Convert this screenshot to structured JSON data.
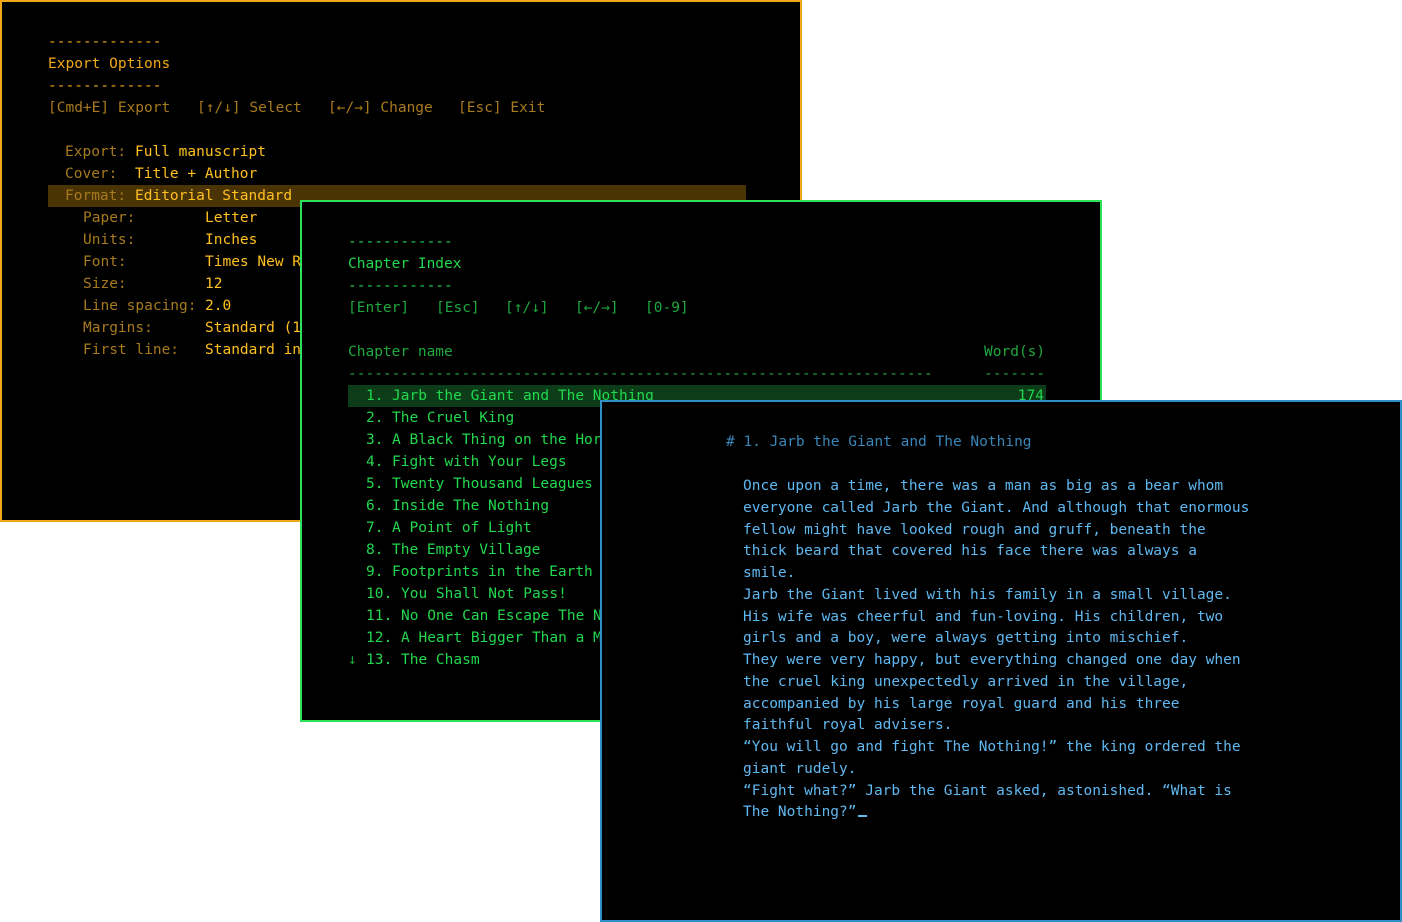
{
  "export": {
    "rule": "-------------",
    "title": "Export Options",
    "shortcuts": [
      "[Cmd+E] Export",
      "[↑/↓] Select",
      "[←/→] Change",
      "[Esc] Exit"
    ],
    "fields": [
      {
        "label": "Export:",
        "value": "Full manuscript"
      },
      {
        "label": "Cover:",
        "value": "Title + Author"
      },
      {
        "label": "Format:",
        "value": "Editorial Standard"
      }
    ],
    "subfields": [
      {
        "label": "Paper:",
        "value": "Letter"
      },
      {
        "label": "Units:",
        "value": "Inches"
      },
      {
        "label": "Font:",
        "value": "Times New R"
      },
      {
        "label": "Size:",
        "value": "12"
      },
      {
        "label": "Line spacing:",
        "value": "2.0"
      },
      {
        "label": "Margins:",
        "value": "Standard (1"
      },
      {
        "label": "First line:",
        "value": "Standard in"
      }
    ]
  },
  "chapters": {
    "rule": "------------",
    "title": "Chapter Index",
    "shortcuts": [
      "[Enter]",
      "[Esc]",
      "[↑/↓]",
      "[←/→]",
      "[0-9]"
    ],
    "col_name": "Chapter name",
    "col_words": "Word(s)",
    "rule_name": "----------------------------------------------------------------------",
    "rule_words": "-------",
    "more_icon": "↓",
    "items": [
      {
        "num": "1.",
        "name": "Jarb the Giant and The Nothing",
        "words": "174"
      },
      {
        "num": "2.",
        "name": "The Cruel King",
        "words": ""
      },
      {
        "num": "3.",
        "name": "A Black Thing on the Hor",
        "words": ""
      },
      {
        "num": "4.",
        "name": "Fight with Your Legs",
        "words": ""
      },
      {
        "num": "5.",
        "name": "Twenty Thousand Leagues",
        "words": ""
      },
      {
        "num": "6.",
        "name": "Inside The Nothing",
        "words": ""
      },
      {
        "num": "7.",
        "name": "A Point of Light",
        "words": ""
      },
      {
        "num": "8.",
        "name": "The Empty Village",
        "words": ""
      },
      {
        "num": "9.",
        "name": "Footprints in the Earth",
        "words": ""
      },
      {
        "num": "10.",
        "name": "You Shall Not Pass!",
        "words": ""
      },
      {
        "num": "11.",
        "name": "No One Can Escape The N",
        "words": ""
      },
      {
        "num": "12.",
        "name": "A Heart Bigger Than a M",
        "words": ""
      },
      {
        "num": "13.",
        "name": "The Chasm",
        "words": ""
      }
    ]
  },
  "editor": {
    "heading": "# 1. Jarb the Giant and The Nothing",
    "lines": [
      "Once upon a time, there was a man as big as a bear whom",
      "everyone called Jarb the Giant. And although that enormous",
      "fellow might have looked rough and gruff, beneath the",
      "thick beard that covered his face there was always a",
      "smile.",
      "Jarb the Giant lived with his family in a small village.",
      "His wife was cheerful and fun-loving. His children, two",
      "girls and a boy, were always getting into mischief.",
      "They were very happy, but everything changed one day when",
      "the cruel king unexpectedly arrived in the village,",
      "accompanied by his large royal guard and his three",
      "faithful royal advisers.",
      "“You will go and fight The Nothing!” the king ordered the",
      "giant rudely.",
      "“Fight what?” Jarb the Giant asked, astonished. “What is",
      "The Nothing?”"
    ]
  },
  "colors": {
    "export_accent": "#f0a818",
    "chapter_accent": "#22d84e",
    "editor_accent": "#60b8f0"
  }
}
